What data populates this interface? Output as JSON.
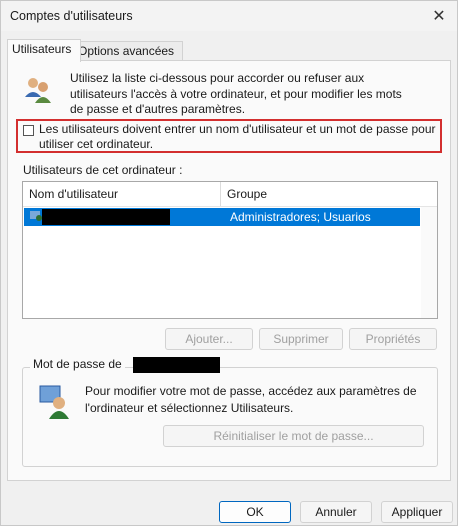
{
  "window": {
    "title": "Comptes d'utilisateurs"
  },
  "tabs": [
    {
      "label": "Utilisateurs"
    },
    {
      "label": "Options avancées"
    }
  ],
  "intro_text": "Utilisez la liste ci-dessous pour accorder ou refuser aux utilisateurs l'accès à votre ordinateur, et pour modifier les mots de passe et d'autres paramètres.",
  "require_login": {
    "checked": false,
    "label": "Les utilisateurs doivent entrer un nom d'utilisateur et un mot de passe pour utiliser cet ordinateur."
  },
  "users_list": {
    "label": "Utilisateurs de cet ordinateur :",
    "columns": [
      "Nom d'utilisateur",
      "Groupe"
    ],
    "rows": [
      {
        "group": "Administradores; Usuarios"
      }
    ]
  },
  "list_buttons": {
    "add": "Ajouter...",
    "remove": "Supprimer",
    "properties": "Propriétés"
  },
  "password_group": {
    "legend": "Mot de passe de",
    "text": "Pour modifier votre mot de passe, accédez aux paramètres de l'ordinateur et sélectionnez Utilisateurs.",
    "reset": "Réinitialiser le mot de passe..."
  },
  "dialog_buttons": {
    "ok": "OK",
    "cancel": "Annuler",
    "apply": "Appliquer"
  },
  "colors": {
    "selection": "#0078d7",
    "highlight_border": "#d32f2f"
  }
}
